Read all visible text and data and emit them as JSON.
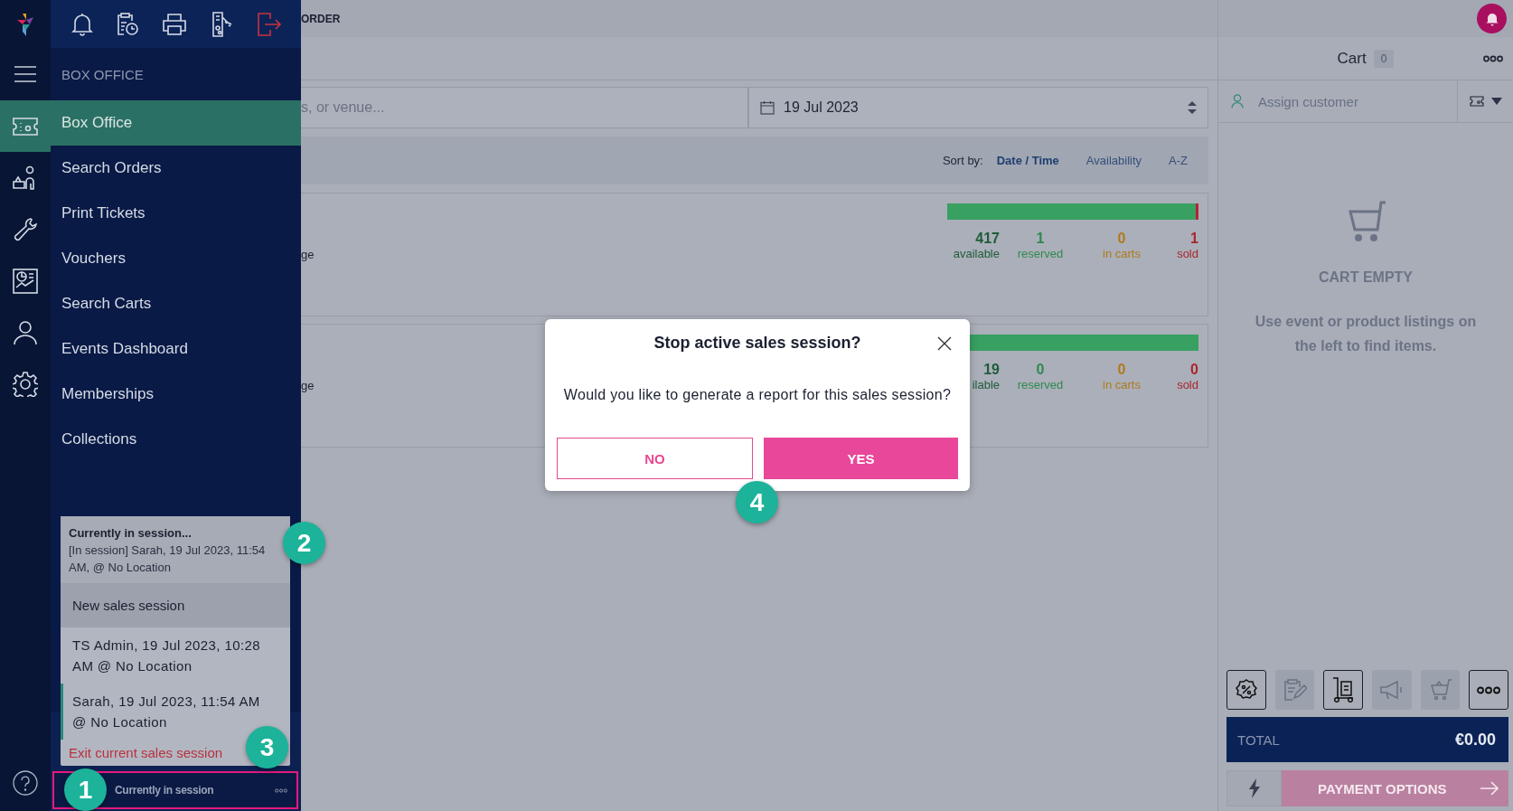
{
  "nav_rail": {
    "items": [
      {
        "selected": true
      },
      {
        "selected": false
      },
      {
        "selected": false
      },
      {
        "selected": false
      },
      {
        "selected": false
      },
      {
        "selected": false
      }
    ]
  },
  "drawer": {
    "heading": "BOX OFFICE",
    "items": [
      {
        "label": "Box Office",
        "selected": true
      },
      {
        "label": "Search Orders",
        "selected": false
      },
      {
        "label": "Print Tickets",
        "selected": false
      },
      {
        "label": "Vouchers",
        "selected": false
      },
      {
        "label": "Search Carts",
        "selected": false
      },
      {
        "label": "Events Dashboard",
        "selected": false
      },
      {
        "label": "Memberships",
        "selected": false
      },
      {
        "label": "Collections",
        "selected": false
      }
    ]
  },
  "session_menu": {
    "heading": "Currently in session...",
    "current": "[In session] Sarah, 19 Jul 2023, 11:54 AM, @ No Location",
    "new_session": "New sales session",
    "sessions": [
      {
        "label": "TS Admin, 19 Jul 2023, 10:28 AM @ No Location",
        "selected": false
      },
      {
        "label": "Sarah, 19 Jul 2023, 11:54 AM @ No Location",
        "selected": true
      }
    ],
    "exit": "Exit current sales session"
  },
  "session_bar": {
    "label": "Currently in session"
  },
  "main": {
    "header_fragment": "ORDER",
    "search": {
      "placeholder": "s, or venue..."
    },
    "date": {
      "value": "19 Jul 2023"
    },
    "sort": {
      "label": "Sort by:",
      "options": [
        {
          "label": "Date / Time",
          "selected": true
        },
        {
          "label": "Availability",
          "selected": false
        },
        {
          "label": "A-Z",
          "selected": false
        }
      ]
    },
    "events": [
      {
        "fragment": "ge",
        "level": 0.99,
        "stats": [
          {
            "value": "417",
            "label": "available",
            "color": "#1f5c3b"
          },
          {
            "value": "1",
            "label": "reserved",
            "color": "#2e8a50"
          },
          {
            "value": "0",
            "label": "in carts",
            "color": "#b07a1c"
          },
          {
            "value": "1",
            "label": "sold",
            "color": "#a8262e"
          }
        ]
      },
      {
        "fragment": "ge",
        "level": 1,
        "stats": [
          {
            "value": "19",
            "label": "ilable",
            "color": "#1f5c3b"
          },
          {
            "value": "0",
            "label": "reserved",
            "color": "#2e8a50"
          },
          {
            "value": "0",
            "label": "in carts",
            "color": "#b07a1c"
          },
          {
            "value": "0",
            "label": "sold",
            "color": "#a8262e"
          }
        ]
      }
    ]
  },
  "cart": {
    "title": "Cart",
    "count": "0",
    "customer": {
      "placeholder": "Assign customer"
    },
    "empty_title": "CART EMPTY",
    "empty_text": "Use event or product listings on the left to find items.",
    "tools": [
      {
        "disabled": false
      },
      {
        "disabled": true
      },
      {
        "disabled": false
      },
      {
        "disabled": true
      },
      {
        "disabled": true
      },
      {
        "disabled": false
      }
    ],
    "total_label": "TOTAL",
    "total": "€0.00",
    "payment": {
      "label": "PAYMENT OPTIONS",
      "disabled": true
    }
  },
  "dialog": {
    "title": "Stop active sales session?",
    "message": "Would you like to generate a report for this sales session?",
    "buttons": [
      {
        "label": "NO",
        "kind": "secondary"
      },
      {
        "label": "YES",
        "kind": "primary"
      }
    ]
  },
  "callouts": [
    "1",
    "2",
    "3",
    "4"
  ]
}
